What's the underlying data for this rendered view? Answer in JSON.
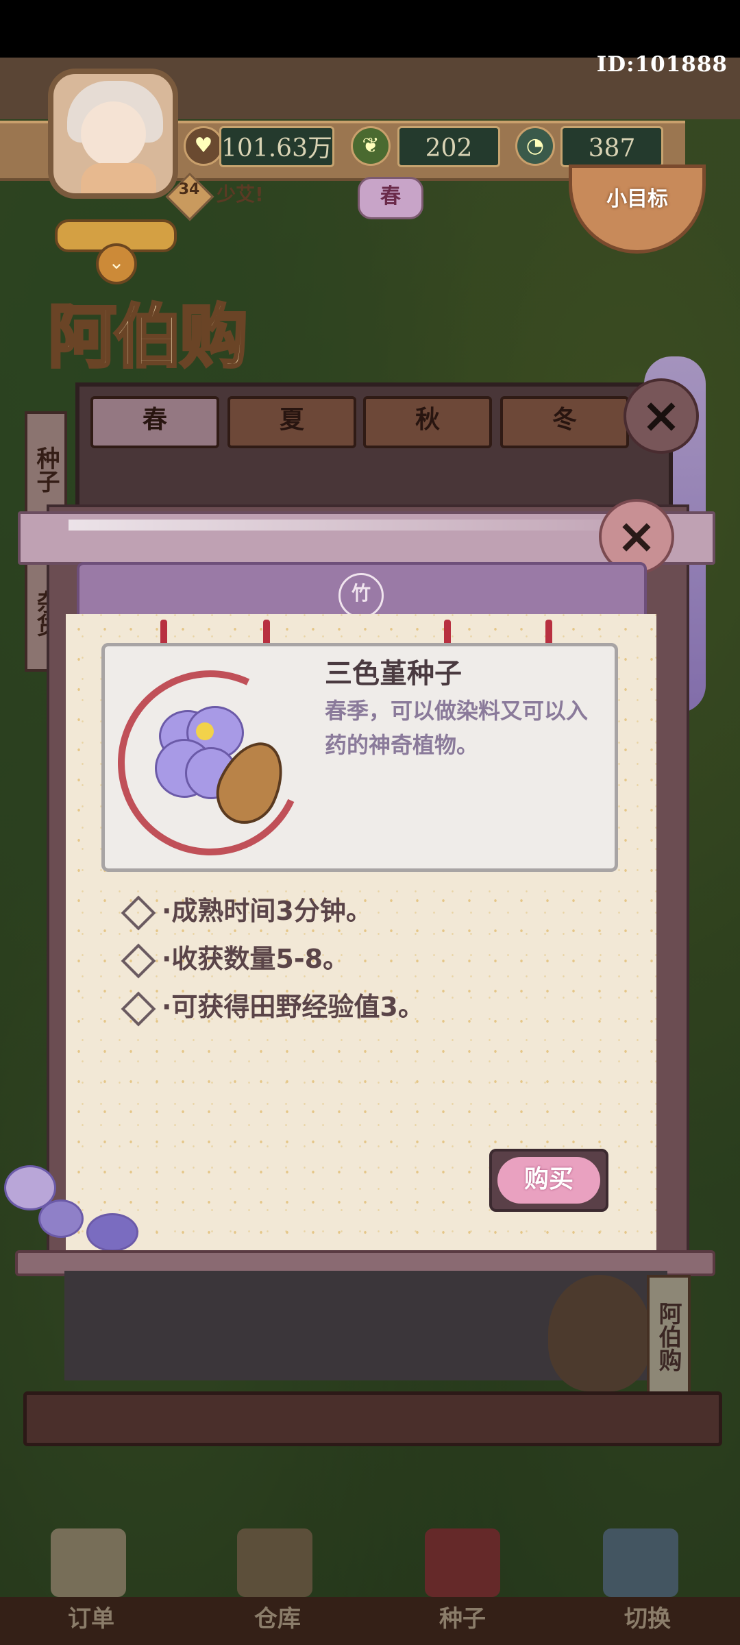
{
  "header": {
    "player_id": "ID:101888",
    "stats": [
      {
        "icon": "heart-coin-icon",
        "value": "101.63万"
      },
      {
        "icon": "leaf-icon",
        "value": "202"
      },
      {
        "icon": "stamina-icon",
        "value": "387"
      }
    ],
    "level": "34",
    "username": "少艾!",
    "season_badge": "春",
    "goal_label": "小目标"
  },
  "shop": {
    "logo_text": "阿伯购",
    "season_tabs": [
      "春",
      "夏",
      "秋",
      "冬"
    ],
    "active_season": "春",
    "side_tabs": [
      "种子",
      "杂货"
    ]
  },
  "modal": {
    "banner_badge": "竹",
    "item_name": "三色堇种子",
    "item_description": "春季，可以做染料又可以入药的神奇植物。",
    "attributes": [
      "·成熟时间3分钟。",
      "·收获数量5-8。",
      "·可获得田野经验值3。"
    ],
    "buy_label": "购买",
    "npc_sign": "阿伯购"
  },
  "bottom_nav": [
    {
      "label": "订单",
      "icon": "order-list-icon"
    },
    {
      "label": "仓库",
      "icon": "warehouse-icon"
    },
    {
      "label": "种子",
      "icon": "seed-book-icon"
    },
    {
      "label": "切换",
      "icon": "map-switch-icon"
    }
  ],
  "colors": {
    "accent_pink": "#e9a1c0",
    "frame_purple": "#9a7aa6",
    "paper": "#f2e8d6",
    "text_dark": "#4a3a40",
    "text_desc": "#8a7a9a"
  }
}
